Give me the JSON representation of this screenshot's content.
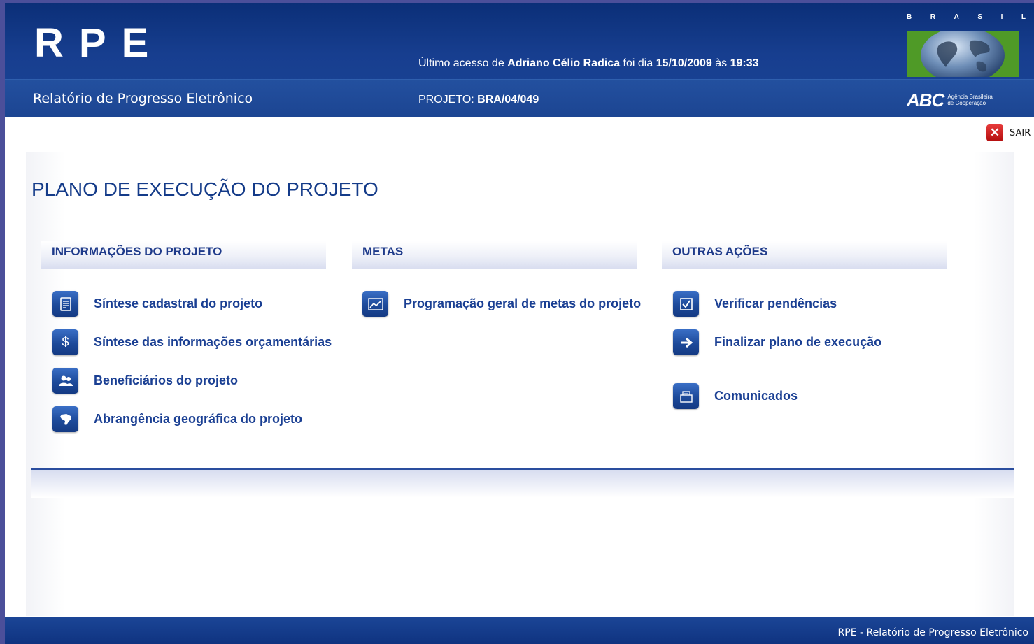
{
  "header": {
    "logo": "RPE",
    "subtitle": "Relatório de Progresso Eletrônico",
    "last_access": {
      "prefix": "Último acesso de",
      "user": "Adriano Célio Radica",
      "date_prefix": "foi dia",
      "date": "15/10/2009",
      "time_prefix": "às",
      "time": "19:33"
    },
    "project": {
      "label": "PROJETO:",
      "code": "BRA/04/049"
    },
    "brand": {
      "country_letters": [
        "B",
        "R",
        "A",
        "S",
        "I",
        "L"
      ],
      "abc": "ABC",
      "agency_line1": "Agência Brasileira",
      "agency_line2": "de Cooperação"
    }
  },
  "logout": {
    "label": "SAIR",
    "icon": "close-icon"
  },
  "page_title": "PLANO DE EXECUÇÃO DO PROJETO",
  "sections": {
    "info": {
      "title": "INFORMAÇÕES DO PROJETO",
      "items": [
        {
          "label": "Síntese cadastral do projeto",
          "icon": "document-icon"
        },
        {
          "label": "Síntese das informações orçamentárias",
          "icon": "dollar-icon"
        },
        {
          "label": "Beneficiários do projeto",
          "icon": "people-icon"
        },
        {
          "label": "Abrangência geográfica do projeto",
          "icon": "brazil-map-icon"
        }
      ]
    },
    "metas": {
      "title": "METAS",
      "items": [
        {
          "label": "Programação geral de metas do projeto",
          "icon": "chart-icon"
        }
      ]
    },
    "outras": {
      "title": "OUTRAS AÇÕES",
      "items": [
        {
          "label": "Verificar pendências",
          "icon": "checkbox-icon"
        },
        {
          "label": "Finalizar plano de execução",
          "icon": "arrow-right-icon"
        },
        {
          "label": "Comunicados",
          "icon": "envelope-icon"
        }
      ]
    }
  },
  "footer": {
    "text": "RPE - Relatório de Progresso Eletrônico"
  },
  "colors": {
    "header_blue": "#173e8f",
    "link_blue": "#1a3f93",
    "logout_red": "#d12020",
    "brand_green": "#4f9a27"
  }
}
